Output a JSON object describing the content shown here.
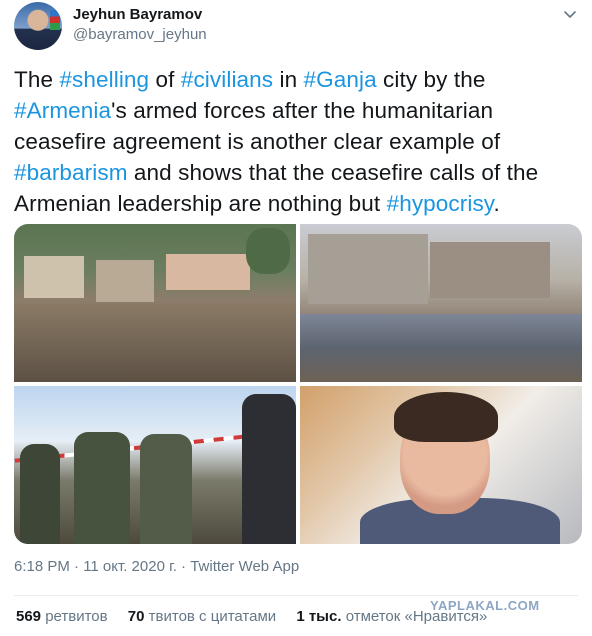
{
  "author": {
    "name": "Jeyhun Bayramov",
    "handle": "@bayramov_jeyhun"
  },
  "tweet": {
    "segments": [
      {
        "text": "The ",
        "tag": false
      },
      {
        "text": "#shelling",
        "tag": true
      },
      {
        "text": " of ",
        "tag": false
      },
      {
        "text": "#civilians",
        "tag": true
      },
      {
        "text": " in ",
        "tag": false
      },
      {
        "text": "#Ganja",
        "tag": true
      },
      {
        "text": " city by the ",
        "tag": false
      },
      {
        "text": "#Armenia",
        "tag": true
      },
      {
        "text": "'s armed forces after the humanitarian ceasefire agreement is another clear example of ",
        "tag": false
      },
      {
        "text": "#barbarism",
        "tag": true
      },
      {
        "text": " and shows that the ceasefire calls of the Armenian leadership are nothing but ",
        "tag": false
      },
      {
        "text": "#hypocrisy",
        "tag": true
      },
      {
        "text": ".",
        "tag": false
      }
    ]
  },
  "meta": {
    "timestamp": "6:18 PM · 11 окт. 2020 г. · Twitter Web App"
  },
  "stats": {
    "retweets_count": "569",
    "retweets_label": "ретвитов",
    "quotes_count": "70",
    "quotes_label": "твитов с цитатами",
    "likes_count": "1 тыс.",
    "likes_label": "отметок «Нравится»"
  },
  "watermark": "YAPLAKAL.COM",
  "colors": {
    "accent": "#1b95e0",
    "text": "#14171a",
    "secondary": "#657786"
  },
  "icons": {
    "menu": "chevron-down-icon"
  }
}
